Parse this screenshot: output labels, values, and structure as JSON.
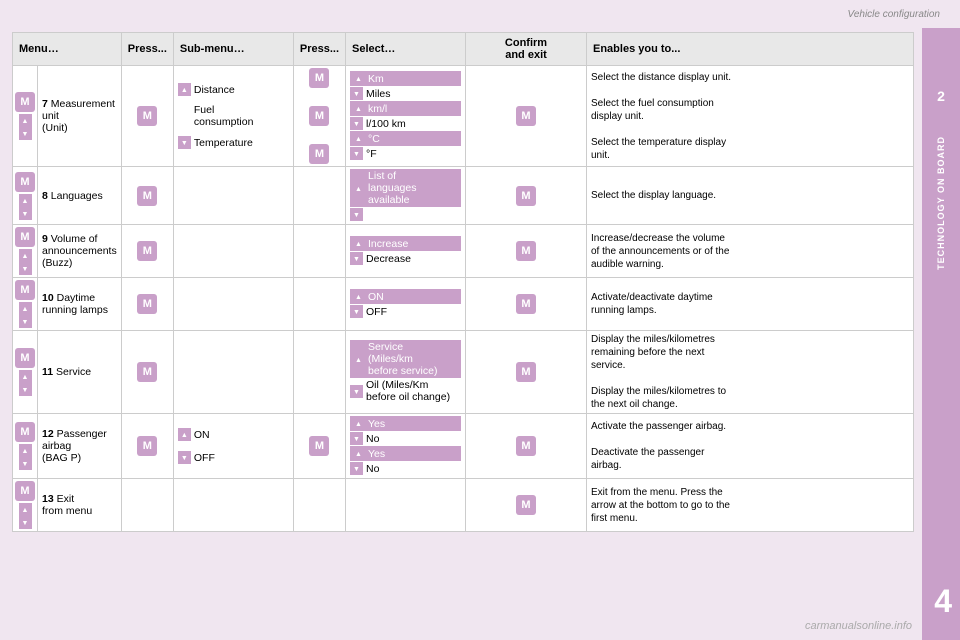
{
  "page": {
    "title": "Vehicle configuration",
    "chapter_number": "2",
    "sidebar_label": "TECHNOLOGY ON BOARD",
    "bottom_number": "4"
  },
  "header": {
    "col1": "Menu…",
    "col2": "Press...",
    "col3": "Sub-menu…",
    "col4": "Press...",
    "col5": "Select…",
    "col6_line1": "Confirm",
    "col6_line2": "and exit",
    "col7": "Enables you to..."
  },
  "rows": [
    {
      "id": "row7",
      "menu_number": "7",
      "menu_text": "Measurement\nunit\n(Unit)",
      "has_arrows": true,
      "has_m": true,
      "submenus": [
        {
          "arrow": "up",
          "label": "Distance",
          "has_m": true
        },
        {
          "arrow": null,
          "label": "Fuel\nconsumption",
          "has_m": true
        },
        {
          "arrow": "down",
          "label": "Temperature",
          "has_m": true
        }
      ],
      "selects": [
        {
          "arrow": "up",
          "label": "Km",
          "highlight": true
        },
        {
          "arrow": "down",
          "label": "Miles",
          "highlight": false
        },
        {
          "arrow": "up",
          "label": "km/l",
          "highlight": true
        },
        {
          "arrow": "down",
          "label": "l/100 km",
          "highlight": false
        },
        {
          "arrow": "up",
          "label": "°C",
          "highlight": true
        },
        {
          "arrow": "down",
          "label": "°F",
          "highlight": false
        }
      ],
      "confirm": true,
      "enables": [
        "Select the distance display unit.",
        "",
        "Select the fuel consumption\ndisplay unit.",
        "",
        "Select the temperature display\nunit."
      ]
    },
    {
      "id": "row8",
      "menu_number": "8",
      "menu_text": "Languages",
      "has_arrows": true,
      "has_m": true,
      "submenus": [],
      "selects": [
        {
          "arrow": "up",
          "label": "List of\nlanguages\navailable",
          "highlight": true
        },
        {
          "arrow": "down",
          "label": "",
          "highlight": false
        }
      ],
      "confirm": true,
      "enables": [
        "Select the display language."
      ]
    },
    {
      "id": "row9",
      "menu_number": "9",
      "menu_text": "Volume of\nannouncements\n(Buzz)",
      "has_arrows": true,
      "has_m": true,
      "submenus": [],
      "selects": [
        {
          "arrow": "up",
          "label": "Increase",
          "highlight": true
        },
        {
          "arrow": "down",
          "label": "Decrease",
          "highlight": false
        }
      ],
      "confirm": true,
      "enables": [
        "Increase/decrease the volume\nof the announcements or of the\naudible warning."
      ]
    },
    {
      "id": "row10",
      "menu_number": "10",
      "menu_text": "Daytime\nrunning lamps",
      "has_arrows": true,
      "has_m": true,
      "submenus": [],
      "selects": [
        {
          "arrow": "up",
          "label": "ON",
          "highlight": true
        },
        {
          "arrow": "down",
          "label": "OFF",
          "highlight": false
        }
      ],
      "confirm": true,
      "enables": [
        "Activate/deactivate daytime\nrunning lamps."
      ]
    },
    {
      "id": "row11",
      "menu_number": "11",
      "menu_text": "Service",
      "has_arrows": true,
      "has_m": true,
      "submenus": [],
      "selects": [
        {
          "arrow": "up",
          "label": "Service\n(Miles/km\nbefore service)",
          "highlight": true
        },
        {
          "arrow": "down",
          "label": "Oil (Miles/Km\nbefore oil change)",
          "highlight": false
        }
      ],
      "confirm": true,
      "enables": [
        "Display the miles/kilometres\nremaining before the next\nservice.",
        "",
        "Display the miles/kilometres to\nthe next oil change."
      ]
    },
    {
      "id": "row12",
      "menu_number": "12",
      "menu_text": "Passenger\nairbag\n(BAG P)",
      "has_arrows": true,
      "has_m": true,
      "submenus": [
        {
          "arrow": "up",
          "label": "ON",
          "has_m": true
        },
        {
          "arrow": "down",
          "label": "OFF",
          "has_m": false
        }
      ],
      "selects": [
        {
          "arrow": "up",
          "label": "Yes",
          "highlight": true
        },
        {
          "arrow": "down",
          "label": "No",
          "highlight": false
        },
        {
          "arrow": "up",
          "label": "Yes",
          "highlight": true
        },
        {
          "arrow": "down",
          "label": "No",
          "highlight": false
        }
      ],
      "confirm": true,
      "enables": [
        "Activate the passenger airbag.",
        "",
        "Deactivate the passenger\nairbag."
      ]
    },
    {
      "id": "row13",
      "menu_number": "13",
      "menu_text": "Exit\nfrom menu",
      "has_arrows": true,
      "has_m": true,
      "submenus": [],
      "selects": [],
      "confirm": true,
      "enables": [
        "Exit from the menu. Press the\narrow at the bottom to go to the\nfirst menu."
      ]
    }
  ],
  "watermark": "carmanualsonline.info"
}
